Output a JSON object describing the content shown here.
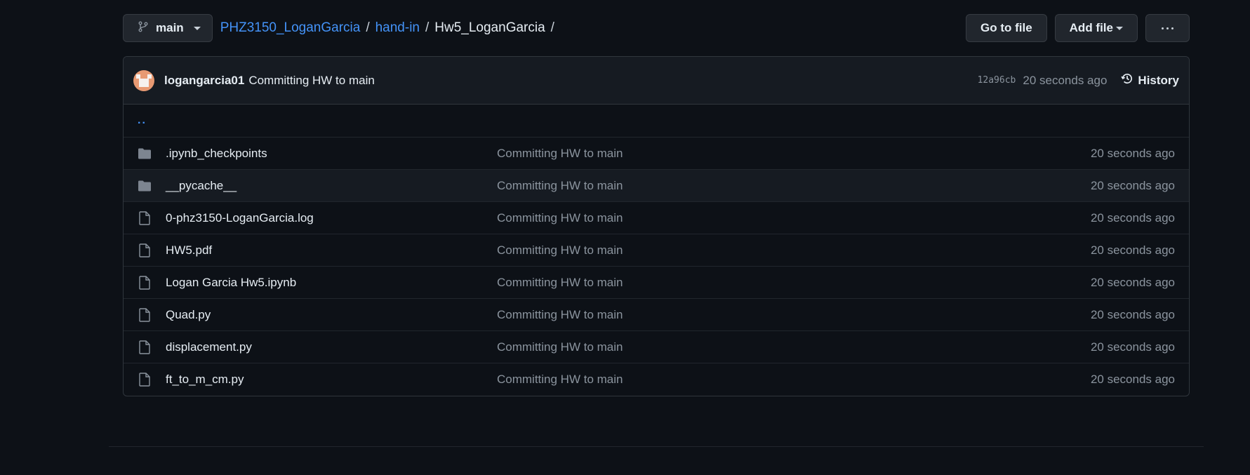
{
  "toolbar": {
    "branch": "main",
    "breadcrumb": {
      "repo": "PHZ3150_LoganGarcia",
      "folder": "hand-in",
      "current": "Hw5_LoganGarcia",
      "separator": "/"
    },
    "go_to_file": "Go to file",
    "add_file": "Add file"
  },
  "commit": {
    "author": "logangarcia01",
    "message": "Committing HW to main",
    "sha": "12a96cb",
    "time": "20 seconds ago",
    "history_label": "History"
  },
  "parent_dir": "..",
  "files": [
    {
      "name": ".ipynb_checkpoints",
      "type": "folder",
      "message": "Committing HW to main",
      "time": "20 seconds ago"
    },
    {
      "name": "__pycache__",
      "type": "folder",
      "message": "Committing HW to main",
      "time": "20 seconds ago"
    },
    {
      "name": "0-phz3150-LoganGarcia.log",
      "type": "file",
      "message": "Committing HW to main",
      "time": "20 seconds ago"
    },
    {
      "name": "HW5.pdf",
      "type": "file",
      "message": "Committing HW to main",
      "time": "20 seconds ago"
    },
    {
      "name": "Logan Garcia Hw5.ipynb",
      "type": "file",
      "message": "Committing HW to main",
      "time": "20 seconds ago"
    },
    {
      "name": "Quad.py",
      "type": "file",
      "message": "Committing HW to main",
      "time": "20 seconds ago"
    },
    {
      "name": "displacement.py",
      "type": "file",
      "message": "Committing HW to main",
      "time": "20 seconds ago"
    },
    {
      "name": "ft_to_m_cm.py",
      "type": "file",
      "message": "Committing HW to main",
      "time": "20 seconds ago"
    }
  ],
  "colors": {
    "background": "#0d1117",
    "link": "#4493f8",
    "muted": "#8b949e",
    "button": "#21262d"
  }
}
